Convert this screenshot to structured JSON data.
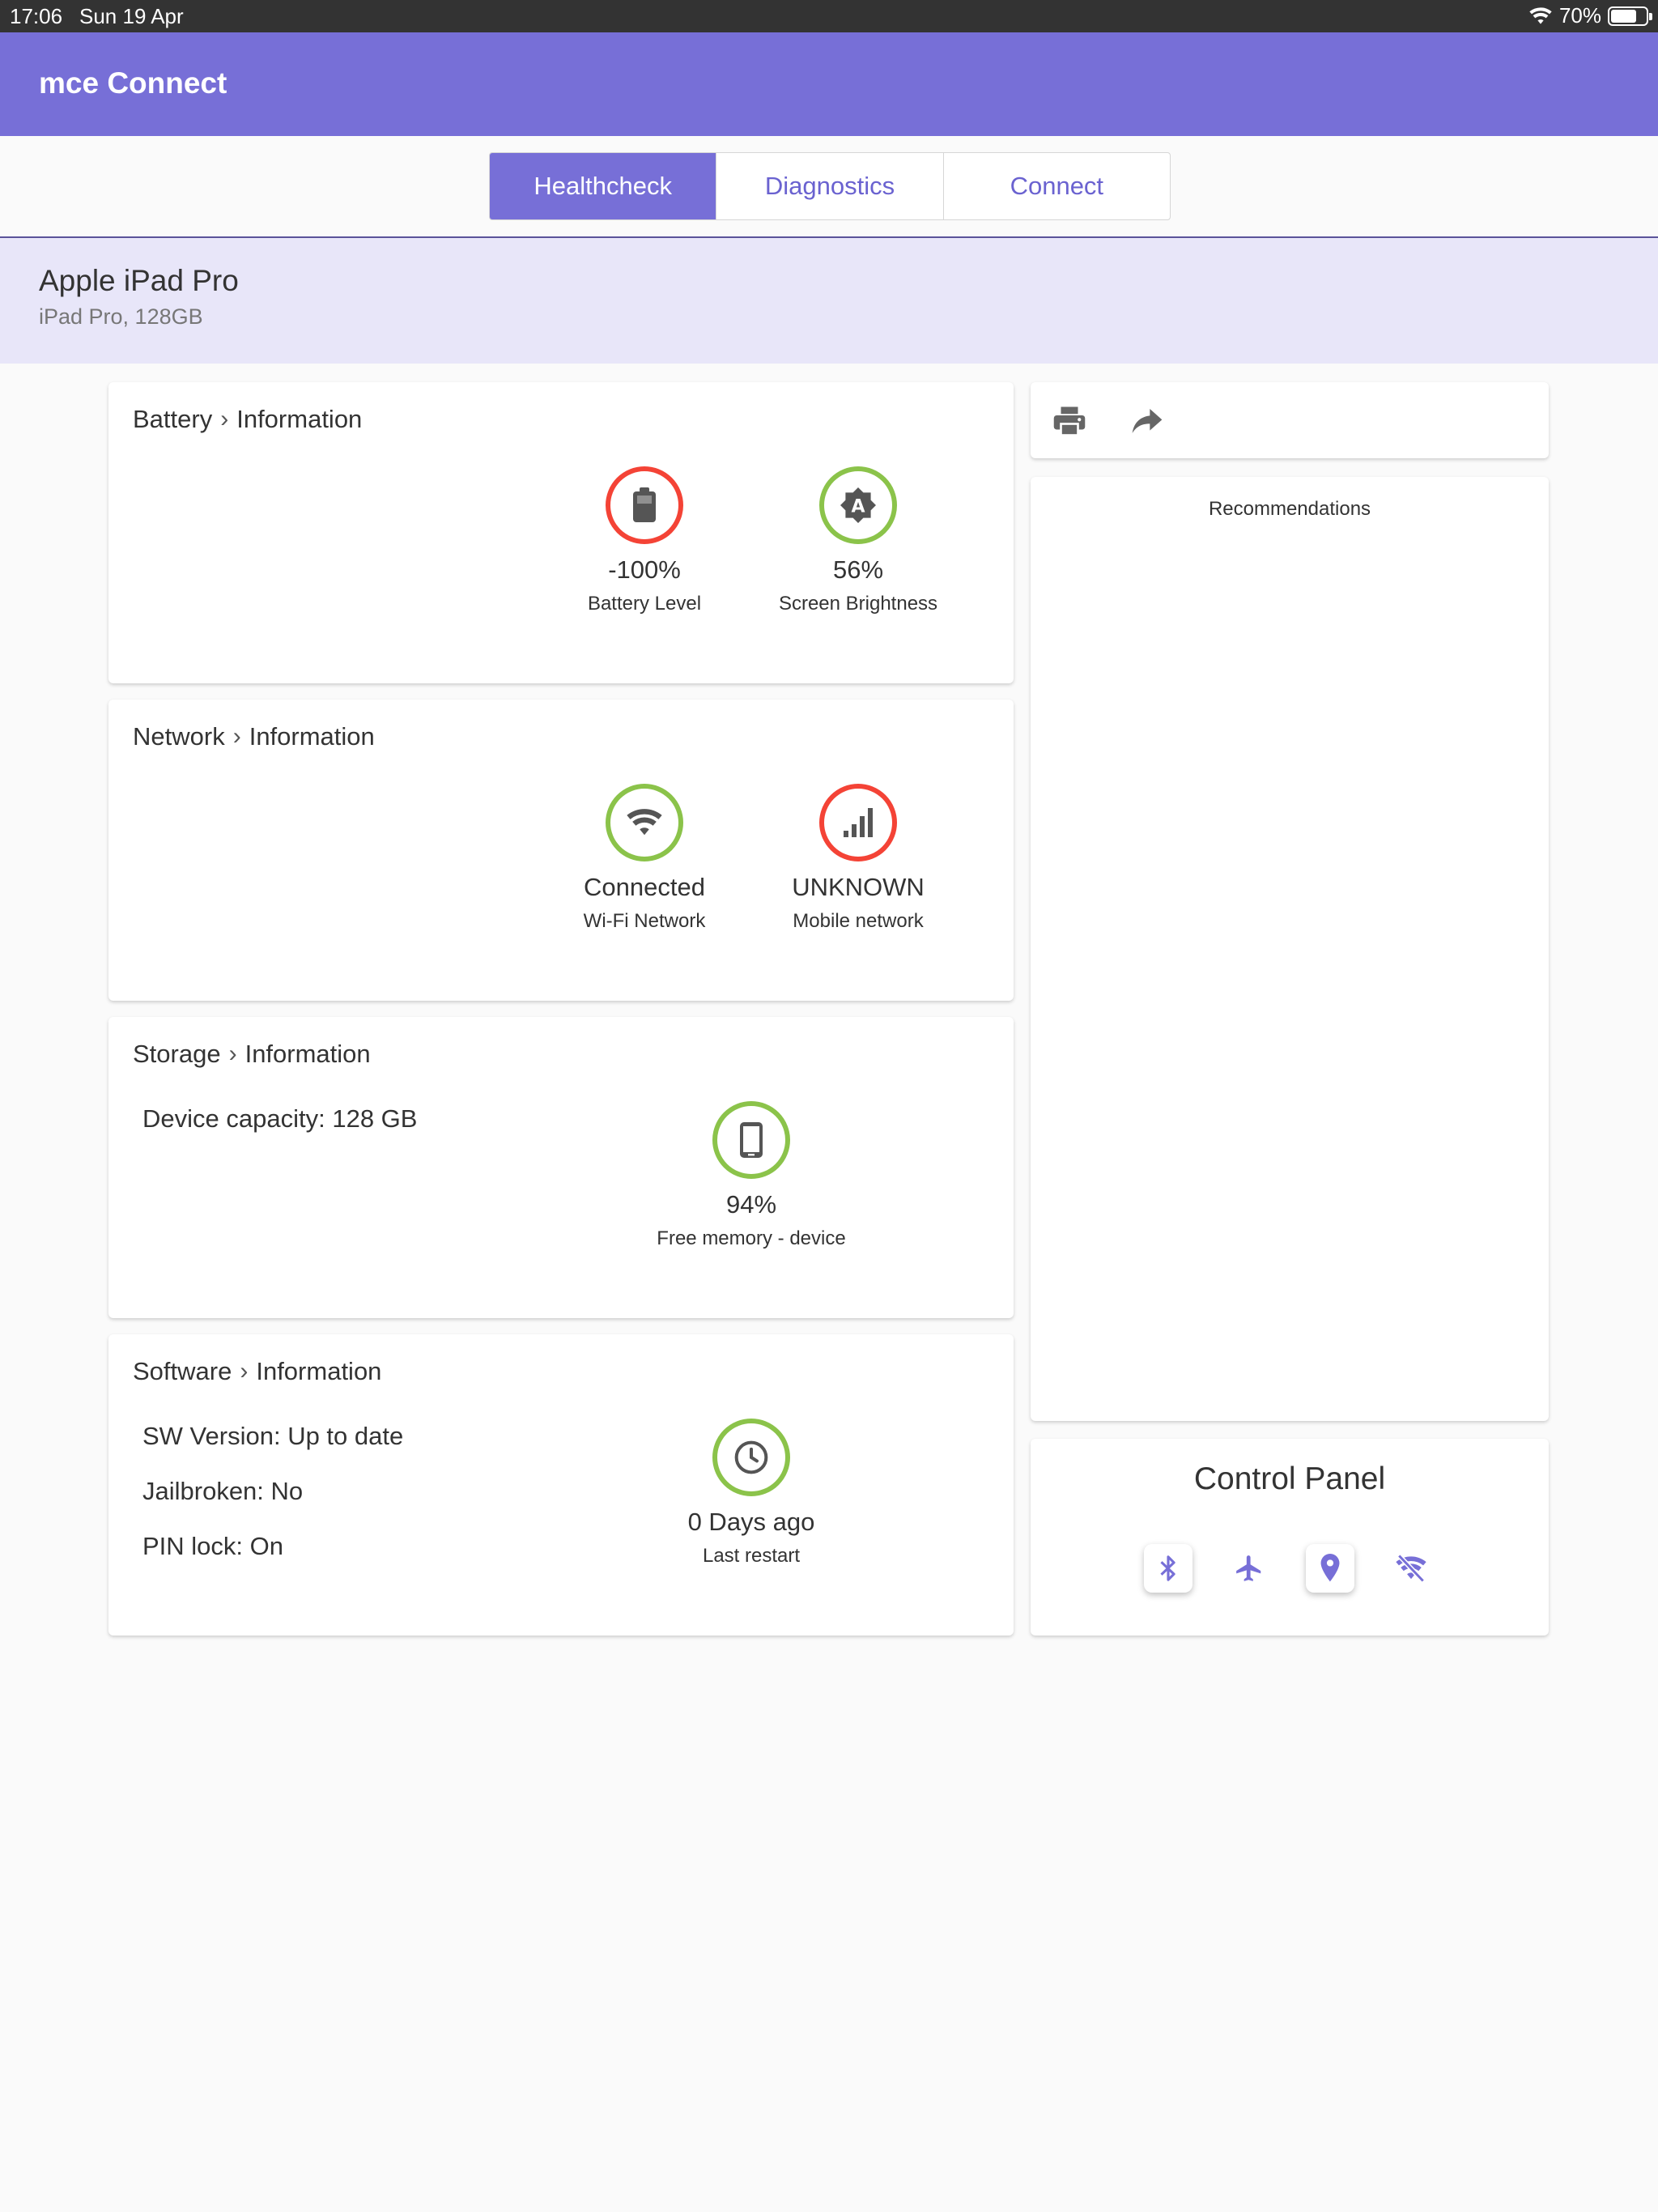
{
  "status_bar": {
    "time": "17:06",
    "date": "Sun 19 Apr",
    "battery": "70%"
  },
  "app": {
    "title": "mce Connect"
  },
  "tabs": [
    {
      "label": "Healthcheck",
      "active": true
    },
    {
      "label": "Diagnostics",
      "active": false
    },
    {
      "label": "Connect",
      "active": false
    }
  ],
  "device": {
    "name": "Apple iPad Pro",
    "model": "iPad Pro, 128GB"
  },
  "battery_card": {
    "section": "Battery",
    "sub": "Information",
    "metrics": [
      {
        "value": "-100%",
        "label": "Battery Level",
        "status": "red",
        "icon": "battery-icon"
      },
      {
        "value": "56%",
        "label": "Screen Brightness",
        "status": "green",
        "icon": "brightness-auto-icon"
      }
    ]
  },
  "network_card": {
    "section": "Network",
    "sub": "Information",
    "metrics": [
      {
        "value": "Connected",
        "label": "Wi-Fi Network",
        "status": "green",
        "icon": "wifi-icon"
      },
      {
        "value": "UNKNOWN",
        "label": "Mobile network",
        "status": "red",
        "icon": "signal-bars-icon"
      }
    ]
  },
  "storage_card": {
    "section": "Storage",
    "sub": "Information",
    "capacity_label": "Device capacity:",
    "capacity_value": "128 GB",
    "metric": {
      "value": "94%",
      "label": "Free memory - device",
      "status": "green",
      "icon": "phone-icon"
    }
  },
  "software_card": {
    "section": "Software",
    "sub": "Information",
    "lines": [
      {
        "label": "SW Version:",
        "value": "Up to date"
      },
      {
        "label": "Jailbroken:",
        "value": "No"
      },
      {
        "label": "PIN lock:",
        "value": "On"
      }
    ],
    "metric": {
      "value": "0 Days ago",
      "label": "Last restart",
      "status": "green",
      "icon": "clock-icon"
    }
  },
  "tools": {
    "icons": [
      "print-icon",
      "share-icon"
    ]
  },
  "recommendations": {
    "title": "Recommendations"
  },
  "control_panel": {
    "title": "Control Panel",
    "buttons": [
      {
        "icon": "bluetooth-icon",
        "active": true
      },
      {
        "icon": "airplane-icon",
        "active": false
      },
      {
        "icon": "location-icon",
        "active": true
      },
      {
        "icon": "wifi-off-icon",
        "active": false
      }
    ]
  },
  "colors": {
    "accent": "#776fd7",
    "header_bg": "#e8e6f9",
    "status_green": "#8bc34a",
    "status_red": "#f44336"
  }
}
